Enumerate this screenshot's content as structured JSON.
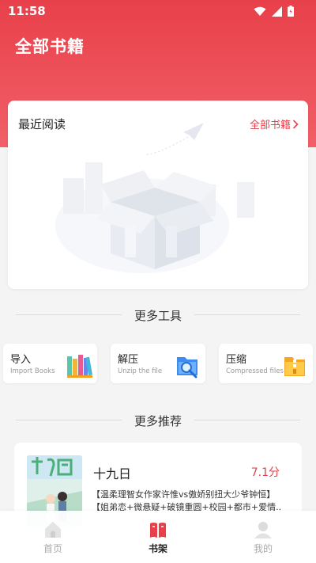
{
  "status_bar": {
    "time": "11:58"
  },
  "header": {
    "title": "全部书籍"
  },
  "recent": {
    "title": "最近阅读",
    "more_label": "全部书籍"
  },
  "tools": {
    "section_title": "更多工具",
    "items": [
      {
        "label": "导入",
        "sub": "Import Books"
      },
      {
        "label": "解压",
        "sub": "Unzip the file"
      },
      {
        "label": "压缩",
        "sub": "Compressed files"
      }
    ]
  },
  "recommend": {
    "section_title": "更多推荐",
    "book": {
      "title": "十九日",
      "score": "7.1分",
      "desc1": "【温柔理智女作家许惟vs傲娇别扭大少爷钟恒】",
      "desc2": "【姐弟恋+微悬疑+破镜重圆+校园+都市+爱情..."
    }
  },
  "tabbar": {
    "items": [
      {
        "label": "首页"
      },
      {
        "label": "书架"
      },
      {
        "label": "我的"
      }
    ]
  },
  "colors": {
    "accent": "#e8404a",
    "header": "#ee4a54",
    "inactive": "#aaaaaa"
  }
}
